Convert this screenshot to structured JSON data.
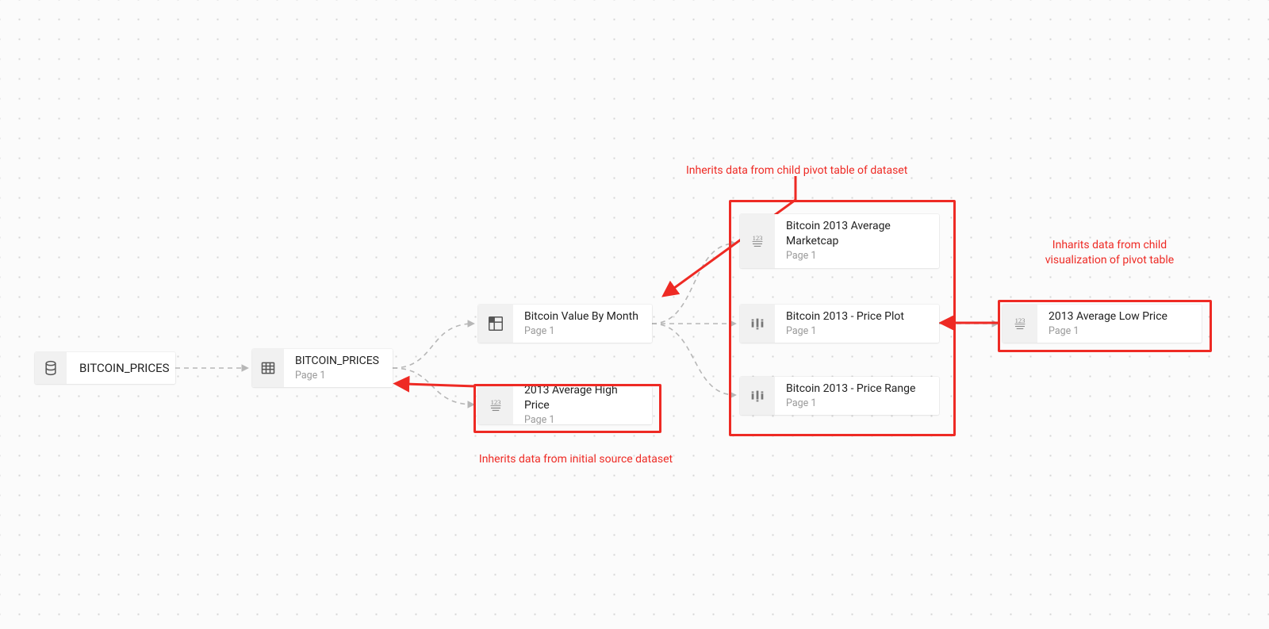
{
  "colors": {
    "annotation": "#ee2a24",
    "node_bg": "#ffffff",
    "node_icon_bg": "#f1f1f1",
    "canvas_bg": "#fbfbfb",
    "dot": "#d5d5d5"
  },
  "annotations": {
    "top": "Inherits data from child pivot table of dataset",
    "bottom": "Inherits data from initial source dataset",
    "right": "Inharits data from child\nvisualization of pivot table"
  },
  "nodes": {
    "source": {
      "title": "BITCOIN_PRICES",
      "icon": "database-icon"
    },
    "dataset": {
      "title": "BITCOIN_PRICES",
      "subtitle": "Page 1",
      "icon": "table-icon"
    },
    "pivot": {
      "title": "Bitcoin Value By Month",
      "subtitle": "Page 1",
      "icon": "pivot-icon"
    },
    "metric_high": {
      "title": "2013 Average High Price",
      "subtitle": "Page 1",
      "icon": "number-icon"
    },
    "metric_marketcap": {
      "title": "Bitcoin 2013 Average Marketcap",
      "subtitle": "Page 1",
      "icon": "number-icon"
    },
    "viz_plot": {
      "title": "Bitcoin 2013 - Price Plot",
      "subtitle": "Page 1",
      "icon": "chart-icon"
    },
    "viz_range": {
      "title": "Bitcoin 2013 - Price Range",
      "subtitle": "Page 1",
      "icon": "chart-icon"
    },
    "metric_low": {
      "title": "2013 Average Low Price",
      "subtitle": "Page 1",
      "icon": "number-icon"
    }
  }
}
